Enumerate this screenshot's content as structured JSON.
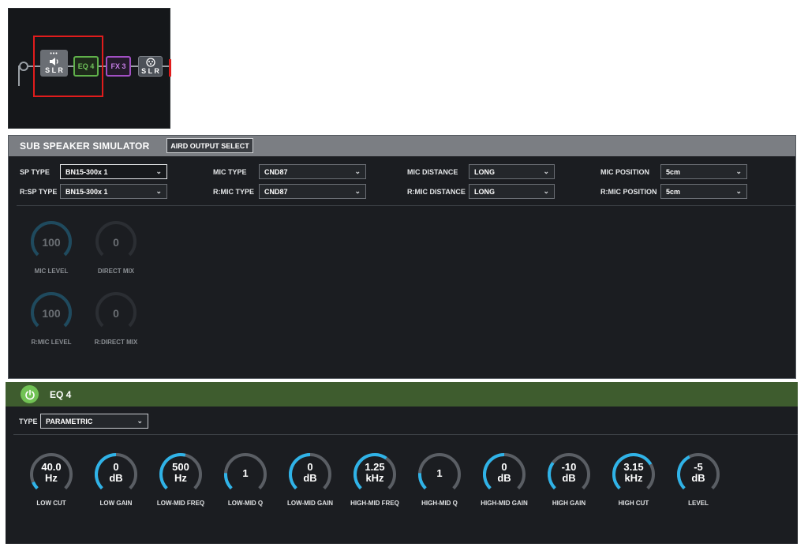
{
  "chain": {
    "speaker_block": {
      "label": "S L R"
    },
    "eq_block": {
      "label": "EQ 4"
    },
    "fx_block": {
      "label": "FX 3"
    },
    "output_block": {
      "label": "S L R"
    }
  },
  "sub": {
    "title": "SUB SPEAKER SIMULATOR",
    "aird_button": "AIRD OUTPUT SELECT",
    "fields": [
      {
        "label": "SP TYPE",
        "value": "BN15-300x 1"
      },
      {
        "label": "R:SP TYPE",
        "value": "BN15-300x 1"
      },
      {
        "label": "MIC TYPE",
        "value": "CND87"
      },
      {
        "label": "R:MIC TYPE",
        "value": "CND87"
      },
      {
        "label": "MIC DISTANCE",
        "value": "LONG"
      },
      {
        "label": "R:MIC DISTANCE",
        "value": "LONG"
      },
      {
        "label": "MIC POSITION",
        "value": "5cm"
      },
      {
        "label": "R:MIC POSITION",
        "value": "5cm"
      }
    ],
    "knobs": [
      {
        "label": "MIC LEVEL",
        "value": "100",
        "level": 1.0
      },
      {
        "label": "DIRECT MIX",
        "value": "0",
        "level": 0.0
      },
      {
        "label": "R:MIC LEVEL",
        "value": "100",
        "level": 1.0
      },
      {
        "label": "R:DIRECT MIX",
        "value": "0",
        "level": 0.0
      }
    ]
  },
  "eq": {
    "title": "EQ 4",
    "type_label": "TYPE",
    "type_value": "PARAMETRIC",
    "knobs": [
      {
        "label": "LOW CUT",
        "line1": "40.0",
        "line2": "Hz",
        "level": 0.08
      },
      {
        "label": "LOW GAIN",
        "line1": "0",
        "line2": "dB",
        "level": 0.5
      },
      {
        "label": "LOW-MID FREQ",
        "line1": "500",
        "line2": "Hz",
        "level": 0.55
      },
      {
        "label": "LOW-MID Q",
        "line1": "1",
        "line2": "",
        "level": 0.18
      },
      {
        "label": "LOW-MID GAIN",
        "line1": "0",
        "line2": "dB",
        "level": 0.5
      },
      {
        "label": "HIGH-MID FREQ",
        "line1": "1.25",
        "line2": "kHz",
        "level": 0.63
      },
      {
        "label": "HIGH-MID Q",
        "line1": "1",
        "line2": "",
        "level": 0.18
      },
      {
        "label": "HIGH-MID GAIN",
        "line1": "0",
        "line2": "dB",
        "level": 0.5
      },
      {
        "label": "HIGH GAIN",
        "line1": "-10",
        "line2": "dB",
        "level": 0.3
      },
      {
        "label": "HIGH CUT",
        "line1": "3.15",
        "line2": "kHz",
        "level": 0.72
      },
      {
        "label": "LEVEL",
        "line1": "-5",
        "line2": "dB",
        "level": 0.4
      }
    ]
  },
  "colors": {
    "accent": "#2fb3e8",
    "eq_header": "#3e5c2e",
    "power": "#71c254",
    "selection": "#e11c1c"
  }
}
